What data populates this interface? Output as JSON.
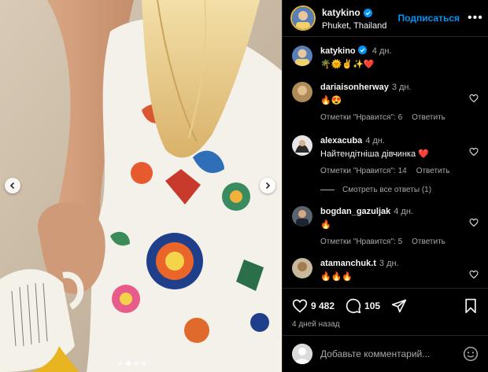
{
  "post": {
    "author": "katykino",
    "location": "Phuket, Thailand",
    "follow_label": "Подписаться",
    "more_label": "•••",
    "caption_time": "4 дн.",
    "caption_text": "🌴🌞✌️✨❤️"
  },
  "comments": [
    {
      "username": "dariaisonherway",
      "time": "3 дн.",
      "text": "🔥😍",
      "likes": "Отметки \"Нравится\": 6",
      "reply": "Ответить"
    },
    {
      "username": "alexacuba",
      "time": "4 дн.",
      "text": "Найтендітніша дівчинка ❤️",
      "likes": "Отметки \"Нравится\": 14",
      "reply": "Ответить"
    },
    {
      "username": "bogdan_gazuljak",
      "time": "4 дн.",
      "text": "🔥",
      "likes": "Отметки \"Нравится\": 5",
      "reply": "Ответить"
    },
    {
      "username": "atamanchuk.t",
      "time": "3 дн.",
      "text": "🔥🔥🔥"
    }
  ],
  "view_replies": "Смотреть все ответы (1)",
  "stats": {
    "likes": "9 482",
    "comments": "105",
    "posted_ago": "4 дней назад"
  },
  "add_comment": {
    "placeholder": "Добавьте комментарий..."
  },
  "colors": {
    "accent": "#0095f6",
    "background": "#000000",
    "muted_text": "#a8a8a8",
    "divider": "#262626",
    "heart_red": "#ed4956"
  },
  "carousel": {
    "slide_count": 4,
    "active_index": 1
  }
}
